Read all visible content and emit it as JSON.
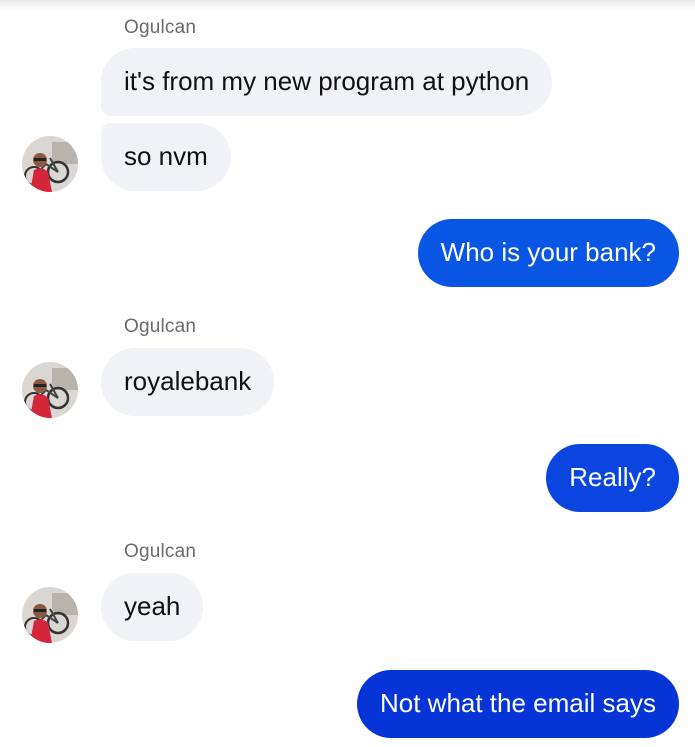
{
  "conversation": {
    "contact_name": "Ogulcan",
    "groups": [
      {
        "sender": "Ogulcan",
        "messages": [
          "it's from my new program at python",
          "so nvm"
        ]
      },
      {
        "sender": "me",
        "messages": [
          "Who is your bank?"
        ]
      },
      {
        "sender": "Ogulcan",
        "messages": [
          "royalebank"
        ]
      },
      {
        "sender": "me",
        "messages": [
          "Really?"
        ]
      },
      {
        "sender": "Ogulcan",
        "messages": [
          "yeah"
        ]
      },
      {
        "sender": "me",
        "messages": [
          "Not what the email says"
        ]
      }
    ]
  },
  "colors": {
    "incoming_bubble": "#f1f2f5",
    "outgoing_bubble_1": "#0a56e4",
    "outgoing_bubble_2": "#0a45e0",
    "outgoing_bubble_3": "#0634d6",
    "sender_name": "#6b6b6b"
  },
  "icons": {
    "avatar": "contact-avatar-photo"
  }
}
